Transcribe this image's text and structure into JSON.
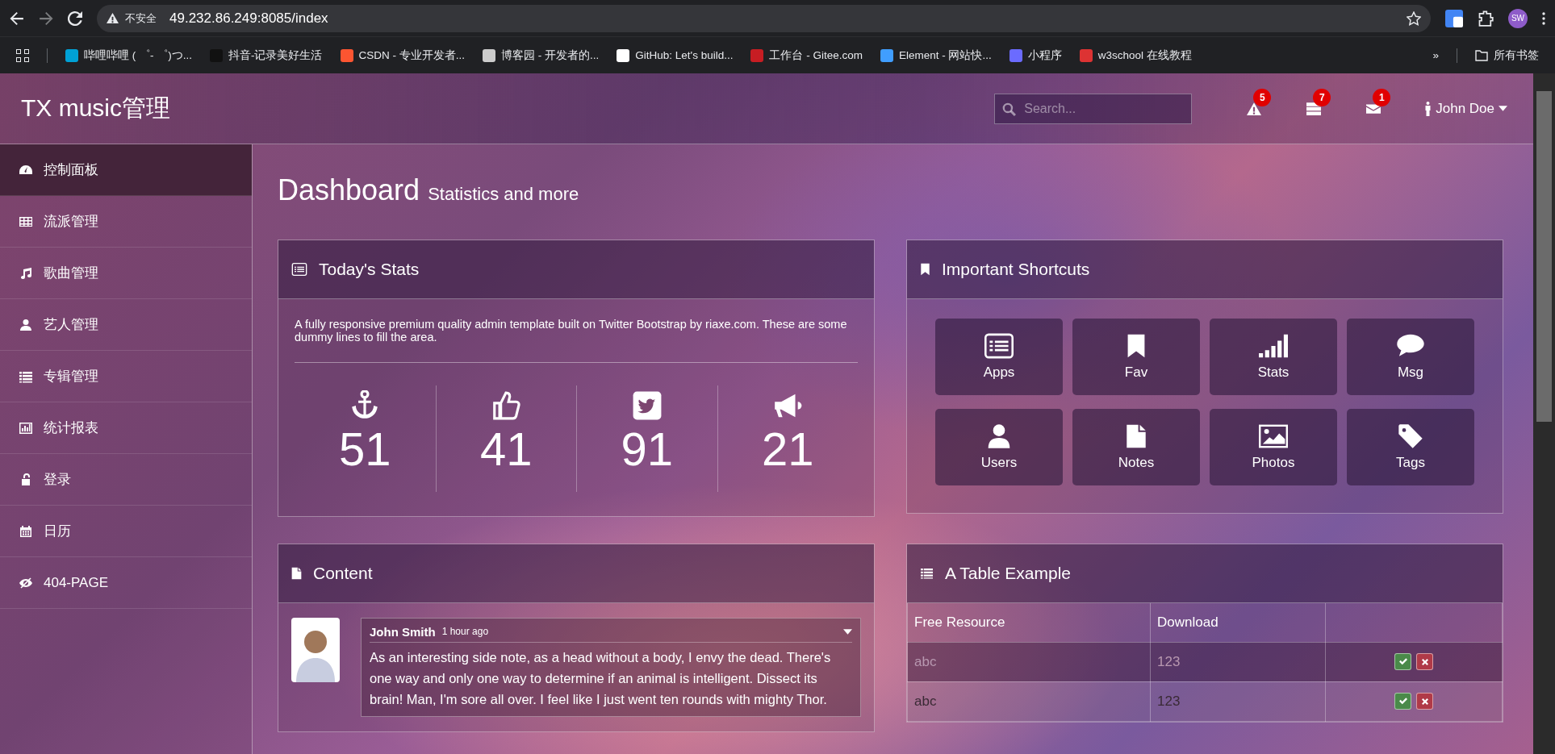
{
  "browser": {
    "security_label": "不安全",
    "url": "49.232.86.249:8085/index",
    "profile": "SW",
    "bookmarks": [
      {
        "label": "哔哩哔哩 ( ゜- ゜)つ..."
      },
      {
        "label": "抖音-记录美好生活"
      },
      {
        "label": "CSDN - 专业开发者..."
      },
      {
        "label": "博客园 - 开发者的..."
      },
      {
        "label": "GitHub: Let's build..."
      },
      {
        "label": "工作台 - Gitee.com"
      },
      {
        "label": "Element - 网站快..."
      },
      {
        "label": "小程序"
      },
      {
        "label": "w3school 在线教程"
      }
    ],
    "more": "»",
    "all_bookmarks": "所有书签"
  },
  "header": {
    "brand": "TX music管理",
    "search": {
      "placeholder": "Search..."
    },
    "notifications": [
      {
        "count": "5"
      },
      {
        "count": "7"
      },
      {
        "count": "1"
      }
    ],
    "user": "John Doe"
  },
  "sidebar": {
    "items": [
      {
        "label": "控制面板",
        "selected": true
      },
      {
        "label": "流派管理",
        "selected": false
      },
      {
        "label": "歌曲管理",
        "selected": false
      },
      {
        "label": "艺人管理",
        "selected": false
      },
      {
        "label": "专辑管理",
        "selected": false
      },
      {
        "label": "统计报表",
        "selected": false
      },
      {
        "label": "登录",
        "selected": false
      },
      {
        "label": "日历",
        "selected": false
      },
      {
        "label": "404-PAGE",
        "selected": false
      }
    ]
  },
  "page": {
    "title": "Dashboard",
    "subtitle": "Statistics and more"
  },
  "stats_card": {
    "title": "Today's Stats",
    "description": "A fully responsive premium quality admin template built on Twitter Bootstrap by riaxe.com. These are some dummy lines to fill the area.",
    "stats": [
      {
        "value": "51"
      },
      {
        "value": "41"
      },
      {
        "value": "91"
      },
      {
        "value": "21"
      }
    ]
  },
  "shortcuts_card": {
    "title": "Important Shortcuts",
    "shortcuts": [
      {
        "label": "Apps"
      },
      {
        "label": "Fav"
      },
      {
        "label": "Stats"
      },
      {
        "label": "Msg"
      },
      {
        "label": "Users"
      },
      {
        "label": "Notes"
      },
      {
        "label": "Photos"
      },
      {
        "label": "Tags"
      }
    ]
  },
  "content_card": {
    "title": "Content",
    "comment": {
      "author": "John Smith",
      "time": "1 hour ago",
      "text": "As an interesting side note, as a head without a body, I envy the dead. There's one way and only one way to determine if an animal is intelligent. Dissect its brain! Man, I'm sore all over. I feel like I just went ten rounds with mighty Thor."
    }
  },
  "table_card": {
    "title": "A Table Example",
    "columns": [
      "Free Resource",
      "Download"
    ],
    "rows": [
      {
        "cells": [
          "abc",
          "123"
        ]
      },
      {
        "cells": [
          "abc",
          "123"
        ]
      }
    ]
  }
}
